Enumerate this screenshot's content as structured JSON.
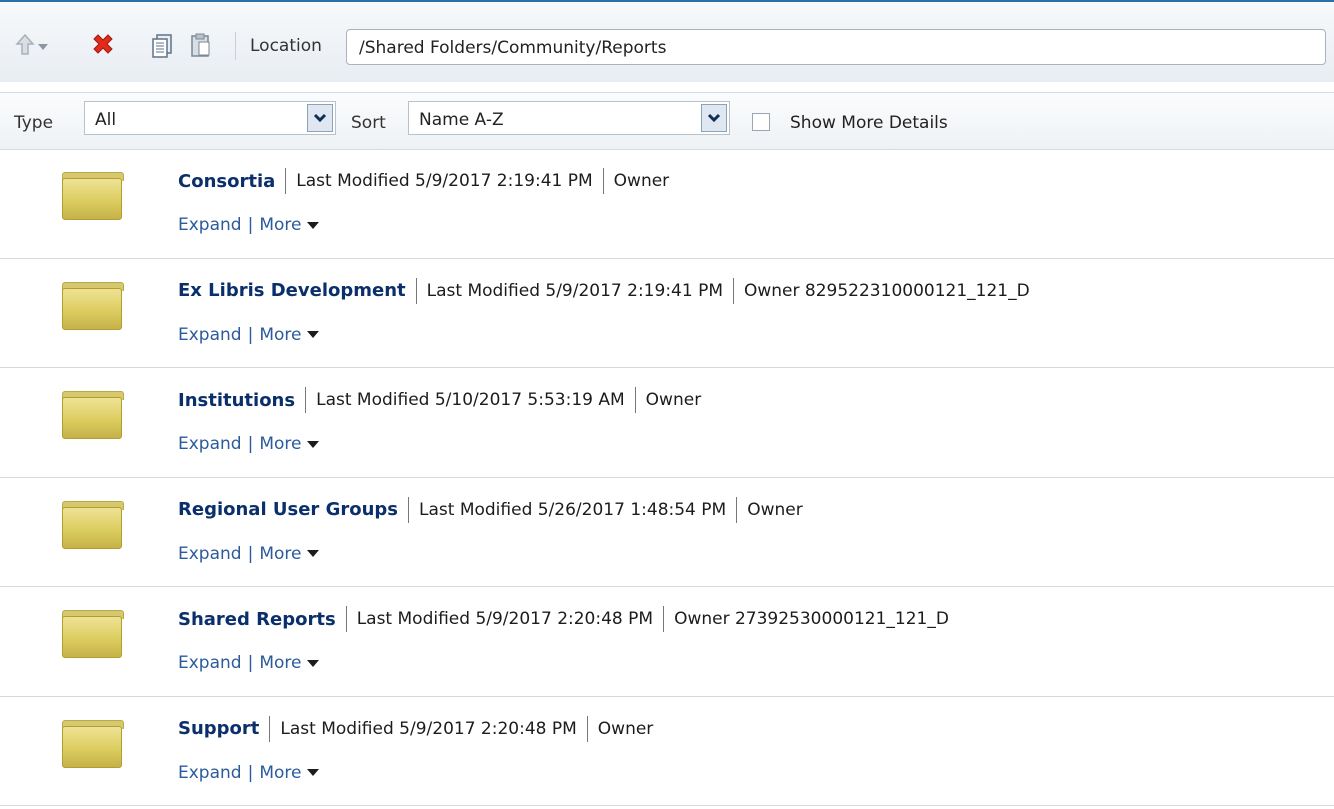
{
  "toolbar": {
    "location_label": "Location",
    "location_value": "/Shared Folders/Community/Reports"
  },
  "filters": {
    "type_label": "Type",
    "type_value": "All",
    "sort_label": "Sort",
    "sort_value": "Name A-Z",
    "show_more_label": "Show More Details",
    "show_more_checked": false
  },
  "items": [
    {
      "name": "Consortia",
      "modified": "Last Modified 5/9/2017 2:19:41 PM",
      "owner": "Owner",
      "expand": "Expand",
      "more": "More"
    },
    {
      "name": "Ex Libris Development",
      "modified": "Last Modified 5/9/2017 2:19:41 PM",
      "owner": "Owner 829522310000121_121_D",
      "expand": "Expand",
      "more": "More"
    },
    {
      "name": "Institutions",
      "modified": "Last Modified 5/10/2017 5:53:19 AM",
      "owner": "Owner",
      "expand": "Expand",
      "more": "More"
    },
    {
      "name": "Regional User Groups",
      "modified": "Last Modified 5/26/2017 1:48:54 PM",
      "owner": "Owner",
      "expand": "Expand",
      "more": "More"
    },
    {
      "name": "Shared Reports",
      "modified": "Last Modified 5/9/2017 2:20:48 PM",
      "owner": "Owner 27392530000121_121_D",
      "expand": "Expand",
      "more": "More"
    },
    {
      "name": "Support",
      "modified": "Last Modified 5/9/2017 2:20:48 PM",
      "owner": "Owner",
      "expand": "Expand",
      "more": "More"
    }
  ],
  "colors": {
    "accent": "#2f6fa8",
    "link": "#2b5b9c",
    "name": "#0a2f6b",
    "folder": "#dccd5f"
  },
  "icons": [
    "up-icon",
    "delete-icon",
    "copy-icon",
    "paste-icon",
    "folder-icon",
    "dropdown-icon"
  ]
}
